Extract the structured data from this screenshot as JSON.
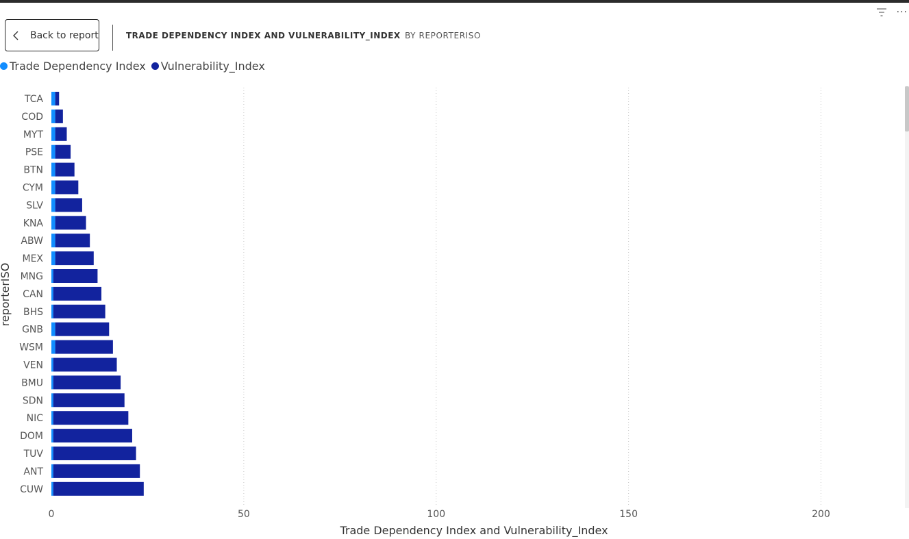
{
  "header": {
    "back_label": "Back to report",
    "title": "TRADE DEPENDENCY INDEX AND VULNERABILITY_INDEX",
    "subtitle": "BY REPORTERISO",
    "icons": [
      "filter-icon",
      "more-options-icon"
    ]
  },
  "legend": {
    "items": [
      {
        "label": "Trade Dependency Index",
        "color": "#118DFF"
      },
      {
        "label": "Vulnerability_Index",
        "color": "#12239E"
      }
    ]
  },
  "chart_data": {
    "type": "bar",
    "orientation": "horizontal",
    "stacked": true,
    "categories": [
      "TCA",
      "COD",
      "MYT",
      "PSE",
      "BTN",
      "CYM",
      "SLV",
      "KNA",
      "ABW",
      "MEX",
      "MNG",
      "CAN",
      "BHS",
      "GNB",
      "WSM",
      "VEN",
      "BMU",
      "SDN",
      "NIC",
      "DOM",
      "TUV",
      "ANT",
      "CUW"
    ],
    "series": [
      {
        "name": "Trade Dependency Index",
        "color": "#118DFF",
        "values": [
          1,
          1,
          1,
          1,
          1,
          1,
          1,
          1,
          1,
          1,
          0.5,
          0.5,
          0.5,
          1,
          1,
          0.5,
          0.5,
          0.5,
          0.5,
          0.5,
          0.5,
          0.5,
          0.5
        ]
      },
      {
        "name": "Vulnerability_Index",
        "color": "#12239E",
        "values": [
          1,
          2,
          3,
          4,
          5,
          6,
          7,
          8,
          9,
          10,
          11.5,
          12.5,
          13.5,
          14,
          15,
          16.5,
          17.5,
          18.5,
          19.5,
          20.5,
          21.5,
          22.5,
          23.5
        ]
      }
    ],
    "xlabel": "Trade Dependency Index and Vulnerability_Index",
    "ylabel": "reporterISO",
    "xlim": [
      0,
      220
    ],
    "xticks": [
      0,
      50,
      100,
      150,
      200
    ],
    "grid": "vertical dotted",
    "legend_position": "top-left"
  }
}
